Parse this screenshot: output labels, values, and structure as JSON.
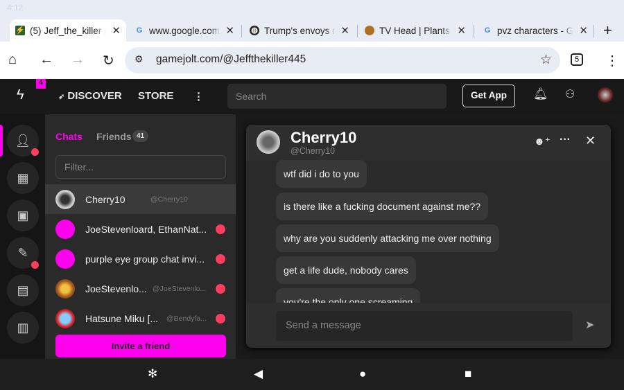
{
  "status": {
    "time": "4:12"
  },
  "tabs": [
    {
      "title": "(5) Jeff_the_killer (",
      "favicon": "gamejolt-icon"
    },
    {
      "title": "www.google.com",
      "favicon": "google-icon"
    },
    {
      "title": "Trump's envoys me",
      "favicon": "globe-icon"
    },
    {
      "title": "TV Head | Plants vs",
      "favicon": "sunflower-icon"
    },
    {
      "title": "pvz characters - Go",
      "favicon": "google-icon"
    }
  ],
  "browser": {
    "url": "gamejolt.com/@Jeffthekiller445",
    "tab_count": "5"
  },
  "app": {
    "notif_count": "4",
    "discover": "DISCOVER",
    "store": "STORE",
    "search_placeholder": "Search",
    "get_app": "Get App",
    "accent": "#ff00ee",
    "panel": {
      "tab_chats": "Chats",
      "tab_friends": "Friends",
      "friends_count": "41",
      "filter_placeholder": "Filter...",
      "items": [
        {
          "name": "Cherry10",
          "handle": "@Cherry10",
          "unread": false
        },
        {
          "name": "JoeStevenloard, EthanNat...",
          "handle": "",
          "unread": true
        },
        {
          "name": "purple eye group chat invi...",
          "handle": "",
          "unread": true
        },
        {
          "name": "JoeStevenlo...",
          "handle": "@JoeStevenlo...",
          "unread": true
        },
        {
          "name": "Hatsune Miku [...",
          "handle": "@Bendyfa...",
          "unread": true
        }
      ],
      "invite": "Invite a friend"
    },
    "chat": {
      "name": "Cherry10",
      "handle": "@Cherry10",
      "messages": [
        "wtf did i do to you",
        "is there like a fucking document against me??",
        "why are you suddenly attacking me over nothing",
        "get a life dude, nobody cares",
        "you're the only one screaming"
      ],
      "placeholder": "Send a message"
    }
  }
}
